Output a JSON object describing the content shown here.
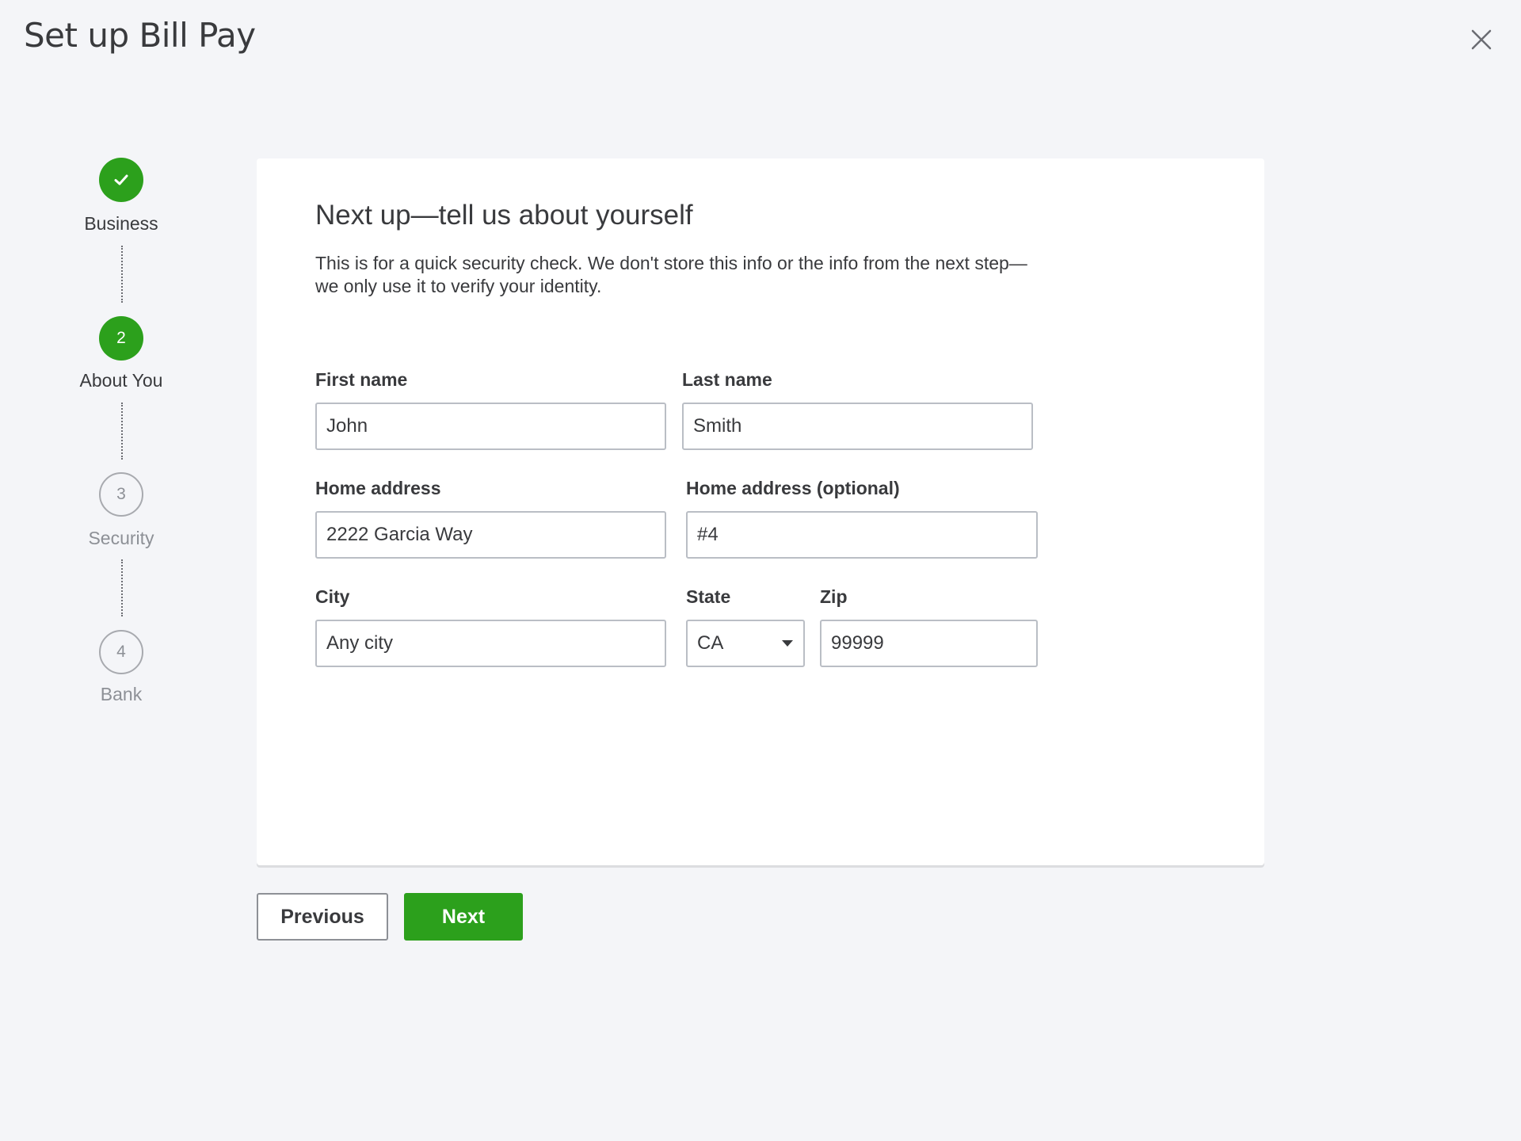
{
  "header": {
    "title": "Set up Bill Pay",
    "close_icon": "close-icon"
  },
  "stepper": {
    "steps": [
      {
        "label": "Business",
        "number": "",
        "status": "done",
        "icon": "checkmark-icon"
      },
      {
        "label": "About You",
        "number": "2",
        "status": "active"
      },
      {
        "label": "Security",
        "number": "3",
        "status": "pending"
      },
      {
        "label": "Bank",
        "number": "4",
        "status": "pending"
      }
    ]
  },
  "form": {
    "heading": "Next up—tell us about yourself",
    "description": "This is for a quick security check. We don't store this info or the info from the next step—we only use it to verify your identity.",
    "first_name": {
      "label": "First name",
      "value": "John"
    },
    "last_name": {
      "label": "Last name",
      "value": "Smith"
    },
    "home_address": {
      "label": "Home address",
      "value": "2222 Garcia Way"
    },
    "home_address_2": {
      "label": "Home address (optional)",
      "value": "#4"
    },
    "city": {
      "label": "City",
      "value": "Any city"
    },
    "state": {
      "label": "State",
      "value": "CA",
      "icon": "caret-down-icon"
    },
    "zip": {
      "label": "Zip",
      "value": "99999"
    }
  },
  "actions": {
    "previous_label": "Previous",
    "next_label": "Next"
  },
  "colors": {
    "accent": "#2ca01c",
    "background": "#f4f5f8",
    "text": "#393a3d",
    "muted": "#8d9096"
  }
}
